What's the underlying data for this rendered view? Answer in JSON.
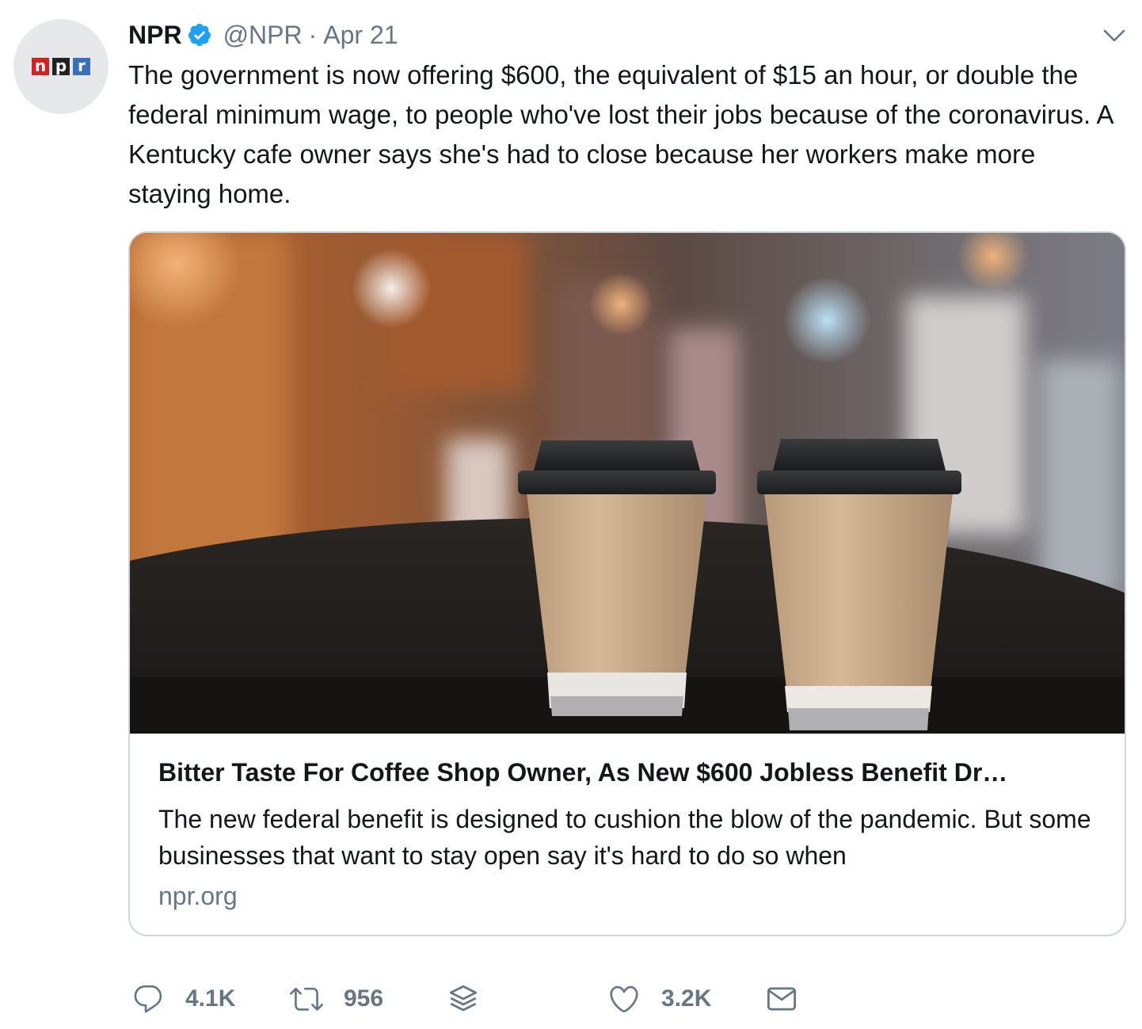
{
  "author": {
    "name": "NPR",
    "handle": "@NPR",
    "separator": "·",
    "date": "Apr 21",
    "verified": true,
    "avatar_letters": [
      "n",
      "p",
      "r"
    ]
  },
  "tweet_text": "The government is now offering $600, the equivalent of $15 an hour, or double the federal minimum wage, to people who've lost their jobs because of the coronavirus. A Kentucky cafe owner says she's had to close because her workers make more staying home.",
  "card": {
    "title": "Bitter Taste For Coffee Shop Owner, As New $600 Jobless Benefit Dr…",
    "description": "The new federal benefit is designed to cushion the blow of the pandemic. But some businesses that want to stay open say it's hard to do so when",
    "domain": "npr.org"
  },
  "actions": {
    "reply_icon": "reply-icon",
    "reply_count": "4.1K",
    "retweet_icon": "retweet-icon",
    "retweet_count": "956",
    "stack_icon": "layers-icon",
    "like_icon": "heart-icon",
    "like_count": "3.2K",
    "dm_icon": "envelope-icon"
  },
  "colors": {
    "text": "#14171a",
    "secondary": "#657786",
    "verified": "#1da1f2",
    "border": "#ccd6dd"
  }
}
